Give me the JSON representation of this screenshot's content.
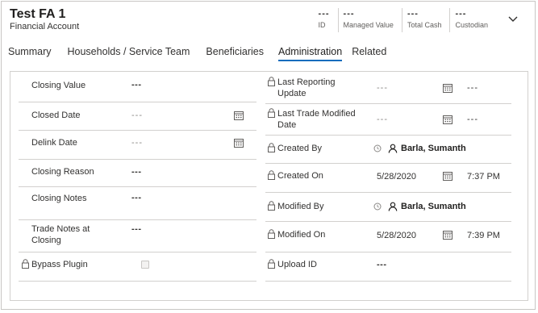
{
  "header": {
    "title": "Test FA 1",
    "subtitle": "Financial Account",
    "kpis": [
      {
        "value": "---",
        "label": "ID"
      },
      {
        "value": "---",
        "label": "Managed Value"
      },
      {
        "value": "---",
        "label": "Total Cash"
      },
      {
        "value": "---",
        "label": "Custodian"
      }
    ],
    "expand_icon": "chevron-down-icon"
  },
  "tabs": [
    {
      "label": "Summary",
      "active": false
    },
    {
      "label": "Households / Service Team",
      "active": false
    },
    {
      "label": "Beneficiaries",
      "active": false
    },
    {
      "label": "Administration",
      "active": true
    },
    {
      "label": "Related",
      "active": false
    }
  ],
  "left": {
    "closing_value": {
      "label": "Closing Value",
      "value": "---"
    },
    "closed_date": {
      "label": "Closed Date",
      "value": "---"
    },
    "delink_date": {
      "label": "Delink Date",
      "value": "---"
    },
    "closing_reason": {
      "label": "Closing Reason",
      "value": "---"
    },
    "closing_notes": {
      "label": "Closing Notes",
      "value": "---"
    },
    "trade_notes": {
      "label_line1": "Trade Notes at",
      "label_line2": "Closing",
      "value": "---"
    },
    "bypass_plugin": {
      "label": "Bypass Plugin",
      "checked": false
    }
  },
  "right": {
    "last_reporting_update": {
      "label_line1": "Last Reporting",
      "label_line2": "Update",
      "date": "---",
      "time": "---"
    },
    "last_trade_modified": {
      "label_line1": "Last Trade Modified",
      "label_line2": "Date",
      "date": "---",
      "time": "---"
    },
    "created_by": {
      "label": "Created By",
      "value": "Barla, Sumanth"
    },
    "created_on": {
      "label": "Created On",
      "date": "5/28/2020",
      "time": "7:37 PM"
    },
    "modified_by": {
      "label": "Modified By",
      "value": "Barla, Sumanth"
    },
    "modified_on": {
      "label": "Modified On",
      "date": "5/28/2020",
      "time": "7:39 PM"
    },
    "upload_id": {
      "label": "Upload ID",
      "value": "---"
    }
  },
  "colors": {
    "accent": "#0f6cbd",
    "border": "#d2d0ce",
    "text": "#323130"
  }
}
